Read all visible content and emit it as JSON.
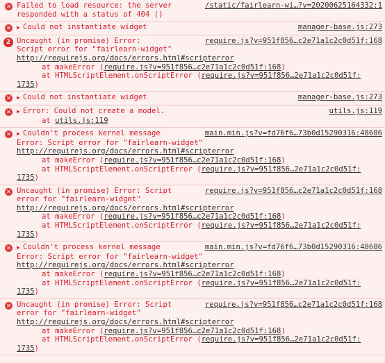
{
  "entries": [
    {
      "icon": "error-icon",
      "count": null,
      "caret": false,
      "head": "Failed to load resource: the server ",
      "source": "/static/fairlearn-wi…?v=20200625164332:1",
      "lines": [
        {
          "text": "responded with a status of 404 ()"
        }
      ]
    },
    {
      "icon": "error-icon",
      "caret": true,
      "head": "Could not instantiate widget",
      "source": "manager-base.js:273",
      "lines": []
    },
    {
      "icon": "error-icon",
      "count": "2",
      "caret": false,
      "head": "Uncaught (in promise) Error: ",
      "source": "require.js?v=951f856…c2e71a1c2c0d51f:168",
      "lines": [
        {
          "text": "Script error for \"fairlearn-widget\""
        },
        {
          "link": "http://requirejs.org/docs/errors.html#scripterror"
        },
        {
          "indent": true,
          "pre": "at makeError (",
          "ilink": "require.js?v=951f856…c2e71a1c2c0d51f:168",
          "post": ")"
        },
        {
          "indent": true,
          "pre": "at HTMLScriptElement.onScriptError (",
          "ilink": "require.js?v=951f856…2e71a1c2c0d51f:",
          "post": ""
        },
        {
          "ilink": "1735",
          "post": ")"
        }
      ]
    },
    {
      "icon": "error-icon",
      "caret": true,
      "head": "Could not instantiate widget",
      "source": "manager-base.js:273",
      "lines": []
    },
    {
      "icon": "error-icon",
      "caret": true,
      "head": "Error: Could not create a model.",
      "source": "utils.js:119",
      "lines": [
        {
          "indent": true,
          "pre": "at ",
          "ilink": "utils.js:119",
          "post": ""
        }
      ]
    },
    {
      "icon": "error-icon",
      "caret": true,
      "head": "Couldn't process kernel message",
      "source": "main.min.js?v=fd76f6…73b0d15290316:48686",
      "lines": [
        {
          "text": "Error: Script error for \"fairlearn-widget\""
        },
        {
          "link": "http://requirejs.org/docs/errors.html#scripterror"
        },
        {
          "indent": true,
          "pre": "at makeError (",
          "ilink": "require.js?v=951f856…c2e71a1c2c0d51f:168",
          "post": ")"
        },
        {
          "indent": true,
          "pre": "at HTMLScriptElement.onScriptError (",
          "ilink": "require.js?v=951f856…2e71a1c2c0d51f:",
          "post": ""
        },
        {
          "ilink": "1735",
          "post": ")"
        }
      ]
    },
    {
      "icon": "error-icon",
      "caret": false,
      "head": "Uncaught (in promise) Error: Script ",
      "source": "require.js?v=951f856…c2e71a1c2c0d51f:168",
      "lines": [
        {
          "text": "error for \"fairlearn-widget\""
        },
        {
          "link": "http://requirejs.org/docs/errors.html#scripterror"
        },
        {
          "indent": true,
          "pre": "at makeError (",
          "ilink": "require.js?v=951f856…c2e71a1c2c0d51f:168",
          "post": ")"
        },
        {
          "indent": true,
          "pre": "at HTMLScriptElement.onScriptError (",
          "ilink": "require.js?v=951f856…2e71a1c2c0d51f:",
          "post": ""
        },
        {
          "ilink": "1735",
          "post": ")"
        }
      ]
    },
    {
      "icon": "error-icon",
      "caret": true,
      "head": "Couldn't process kernel message",
      "source": "main.min.js?v=fd76f6…73b0d15290316:48686",
      "lines": [
        {
          "text": "Error: Script error for \"fairlearn-widget\""
        },
        {
          "link": "http://requirejs.org/docs/errors.html#scripterror"
        },
        {
          "indent": true,
          "pre": "at makeError (",
          "ilink": "require.js?v=951f856…c2e71a1c2c0d51f:168",
          "post": ")"
        },
        {
          "indent": true,
          "pre": "at HTMLScriptElement.onScriptError (",
          "ilink": "require.js?v=951f856…2e71a1c2c0d51f:",
          "post": ""
        },
        {
          "ilink": "1735",
          "post": ")"
        }
      ]
    },
    {
      "icon": "error-icon",
      "caret": false,
      "head": "Uncaught (in promise) Error: Script ",
      "source": "require.js?v=951f856…c2e71a1c2c0d51f:168",
      "lines": [
        {
          "text": "error for \"fairlearn-widget\""
        },
        {
          "link": "http://requirejs.org/docs/errors.html#scripterror"
        },
        {
          "indent": true,
          "pre": "at makeError (",
          "ilink": "require.js?v=951f856…c2e71a1c2c0d51f:168",
          "post": ")"
        },
        {
          "indent": true,
          "pre": "at HTMLScriptElement.onScriptError (",
          "ilink": "require.js?v=951f856…2e71a1c2c0d51f:",
          "post": ""
        },
        {
          "ilink": "1735",
          "post": ")"
        }
      ]
    }
  ]
}
